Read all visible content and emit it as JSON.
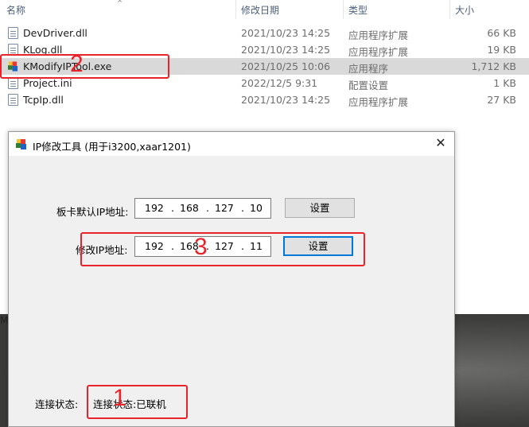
{
  "explorer": {
    "columns": {
      "name": "名称",
      "modified": "修改日期",
      "type": "类型",
      "size": "大小"
    },
    "files": [
      {
        "name": "DevDriver.dll",
        "modified": "2021/10/23 14:25",
        "type": "应用程序扩展",
        "size": "66 KB",
        "icon": "dll-file-icon"
      },
      {
        "name": "KLog.dll",
        "modified": "2021/10/23 14:25",
        "type": "应用程序扩展",
        "size": "19 KB",
        "icon": "dll-file-icon"
      },
      {
        "name": "KModifyIPTool.exe",
        "modified": "2021/10/25 10:06",
        "type": "应用程序",
        "size": "1,712 KB",
        "icon": "exe-app-icon"
      },
      {
        "name": "Project.ini",
        "modified": "2022/12/5 9:31",
        "type": "配置设置",
        "size": "1 KB",
        "icon": "ini-file-icon"
      },
      {
        "name": "TcpIp.dll",
        "modified": "2021/10/23 14:25",
        "type": "应用程序扩展",
        "size": "27 KB",
        "icon": "dll-file-icon"
      }
    ],
    "selected_index": 2,
    "background_label": "M"
  },
  "dialog": {
    "title": "IP修改工具 (用于i3200,xaar1201)",
    "close_glyph": "✕",
    "default_ip": {
      "label": "板卡默认IP地址:",
      "octets": [
        "192",
        "168",
        "127",
        "10"
      ],
      "button": "设置"
    },
    "modify_ip": {
      "label": "修改IP地址:",
      "octets": [
        "192",
        "168",
        "127",
        "11"
      ],
      "button": "设置"
    },
    "status": {
      "label": "连接状态:",
      "value": "连接状态:已联机"
    }
  },
  "annotations": {
    "color": "#e8232a",
    "numbers": [
      "1",
      "2",
      "3"
    ]
  },
  "colors": {
    "selection": "#d9d9d9",
    "dialog_bg": "#f0f0f0",
    "focus_blue": "#0078d7"
  }
}
